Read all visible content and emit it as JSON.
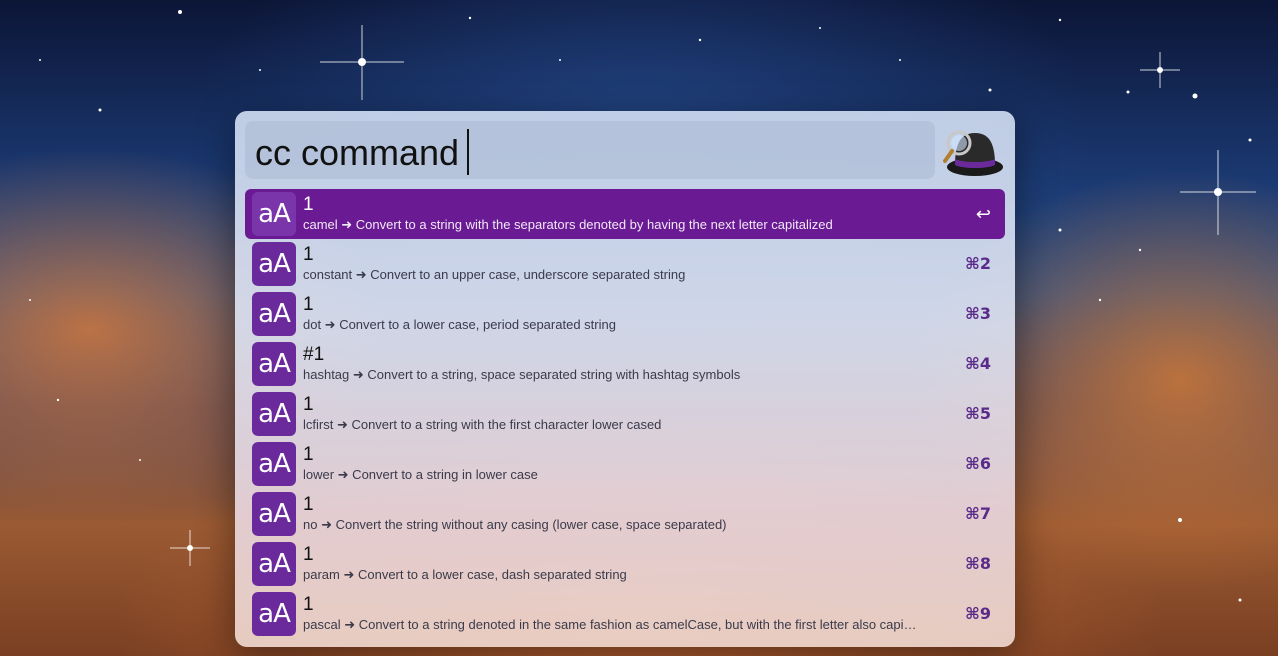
{
  "search": {
    "query": "cc command"
  },
  "app": {
    "icon": "alfred-hat-icon"
  },
  "results": [
    {
      "title": "1",
      "subtitle": "camel ➜ Convert to a string with the separators denoted by having the next letter capitalized",
      "shortcut": "↩",
      "selected": true
    },
    {
      "title": "1",
      "subtitle": "constant ➜ Convert to an upper case, underscore separated string",
      "shortcut": "⌘2"
    },
    {
      "title": "1",
      "subtitle": "dot ➜ Convert to a lower case, period separated string",
      "shortcut": "⌘3"
    },
    {
      "title": "#1",
      "subtitle": "hashtag ➜ Convert to a string, space separated string with hashtag symbols",
      "shortcut": "⌘4"
    },
    {
      "title": "1",
      "subtitle": "lcfirst ➜ Convert to a string with the first character lower cased",
      "shortcut": "⌘5"
    },
    {
      "title": "1",
      "subtitle": "lower ➜ Convert to a string in lower case",
      "shortcut": "⌘6"
    },
    {
      "title": "1",
      "subtitle": "no ➜ Convert the string without any casing (lower case, space separated)",
      "shortcut": "⌘7"
    },
    {
      "title": "1",
      "subtitle": "param ➜ Convert to a lower case, dash separated string",
      "shortcut": "⌘8"
    },
    {
      "title": "1",
      "subtitle": "pascal ➜ Convert to a string denoted in the same fashion as camelCase, but with the first letter also capi…",
      "shortcut": "⌘9"
    }
  ],
  "result_icon_text": "aA",
  "colors": {
    "accent": "#6a1b94",
    "icon_bg": "#6a2a9c"
  }
}
